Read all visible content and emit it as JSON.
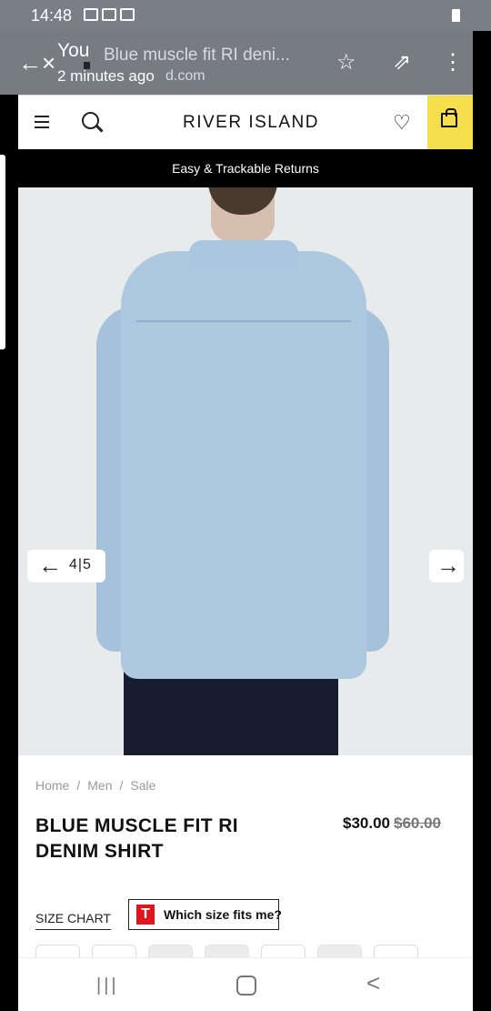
{
  "statusbar": {
    "time": "14:48",
    "right_text": "..\u0017́̑́",
    "icons": [
      "image-icon",
      "youtube-icon",
      "domino-icon",
      "wifi-icon",
      "signal-icon",
      "battery-icon"
    ]
  },
  "browser": {
    "title_prefix": "You",
    "page_title": "Blue muscle fit RI deni...",
    "subtitle": "2 minutes ago",
    "domain_suffix": "d.com"
  },
  "site": {
    "brand": "RIVER ISLAND",
    "promo": "Easy & Trackable Returns",
    "gallery": {
      "counter": "4|5"
    },
    "breadcrumb": [
      "Home",
      "Men",
      "Sale"
    ],
    "product_name": "BLUE MUSCLE FIT RI DENIM SHIRT",
    "price": "$30.00",
    "old_price": "$60.00",
    "size_chart": "SIZE CHART",
    "fit_button": "Which size fits me?",
    "fit_logo": "T"
  },
  "nav": {
    "recent": "|||",
    "back": "<"
  },
  "colors": {
    "accent": "#f5df4d",
    "promo_bg": "#000000",
    "fit_logo": "#e1151f"
  }
}
